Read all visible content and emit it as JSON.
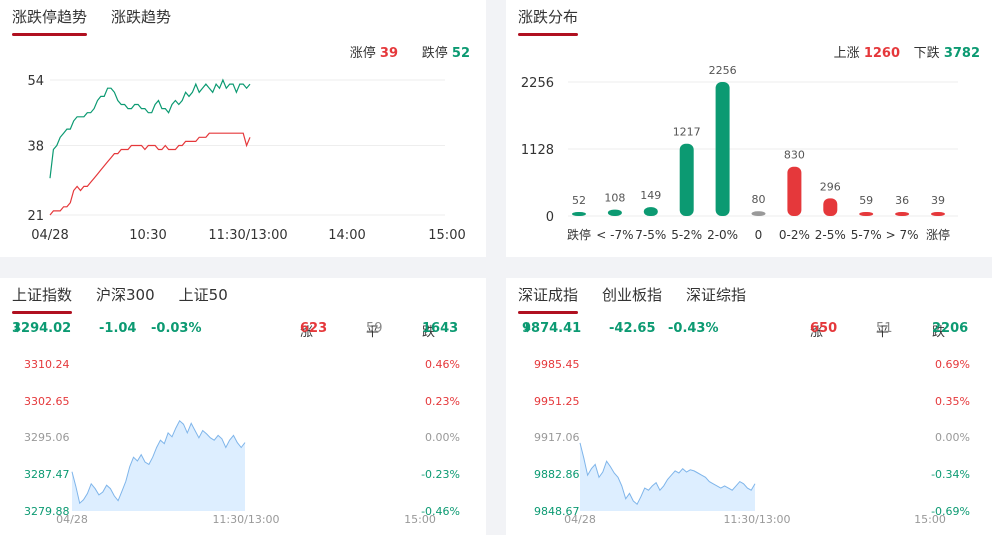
{
  "limit_panel": {
    "tabs": [
      {
        "label": "涨跌停趋势"
      },
      {
        "label": "涨跌趋势"
      }
    ],
    "limit_up_label": "涨停",
    "limit_up_value": "39",
    "limit_down_label": "跌停",
    "limit_down_value": "52",
    "colors": {
      "up": "#e5383b",
      "down": "#0c9a72"
    }
  },
  "dist_panel": {
    "tabs": [
      {
        "label": "涨跌分布"
      }
    ],
    "rise_label": "上涨",
    "rise_value": "1260",
    "fall_label": "下跌",
    "fall_value": "3782"
  },
  "sh_panel": {
    "tabs": [
      {
        "label": "上证指数"
      },
      {
        "label": "沪深300"
      },
      {
        "label": "上证50"
      }
    ],
    "price": "3294.02",
    "change": "-1.04",
    "change_pct": "-0.03%",
    "up_label": "涨",
    "up_value": "623",
    "flat_label": "平",
    "flat_value": "59",
    "down_label": "跌",
    "down_value": "1643"
  },
  "sz_panel": {
    "tabs": [
      {
        "label": "深证成指"
      },
      {
        "label": "创业板指"
      },
      {
        "label": "深证综指"
      }
    ],
    "price": "9874.41",
    "change": "-42.65",
    "change_pct": "-0.43%",
    "up_label": "涨",
    "up_value": "650",
    "flat_label": "平",
    "flat_value": "51",
    "down_label": "跌",
    "down_value": "2206"
  },
  "chart_data": [
    {
      "type": "line",
      "x_ticks": [
        "04/28",
        "10:30",
        "11:30/13:00",
        "14:00",
        "15:00"
      ],
      "y_ticks": [
        54,
        38,
        21
      ],
      "ylim": [
        21,
        54
      ],
      "series": [
        {
          "color": "#0c9a72",
          "values": [
            30,
            37,
            38,
            40,
            41,
            42,
            42,
            44,
            45,
            45,
            45,
            46,
            46,
            47,
            49,
            50,
            50,
            52,
            52,
            51,
            49,
            48,
            48,
            47,
            47,
            48,
            48,
            47,
            47,
            46,
            46,
            48,
            49,
            47,
            47,
            46,
            48,
            49,
            48,
            49,
            51,
            50,
            51,
            53,
            51,
            52,
            53,
            52,
            51,
            53,
            52,
            54,
            52,
            53,
            53,
            51,
            53,
            53,
            52,
            53
          ]
        },
        {
          "color": "#e5383b",
          "values": [
            21,
            22,
            22,
            22,
            23,
            23,
            24,
            27,
            28,
            27,
            28,
            28,
            29,
            30,
            31,
            32,
            33,
            34,
            35,
            36,
            36,
            37,
            37,
            37,
            38,
            38,
            38,
            38,
            37,
            38,
            38,
            38,
            37,
            37,
            38,
            37,
            37,
            37,
            38,
            38,
            39,
            39,
            39,
            39,
            40,
            40,
            40,
            41,
            41,
            41,
            41,
            41,
            41,
            41,
            41,
            41,
            41,
            41,
            38,
            40
          ]
        }
      ]
    },
    {
      "type": "bar",
      "categories": [
        "跌停",
        "< -7%",
        "7-5%",
        "5-2%",
        "2-0%",
        "0",
        "0-2%",
        "2-5%",
        "5-7%",
        "> 7%",
        "涨停"
      ],
      "values": [
        52,
        108,
        149,
        1217,
        2256,
        80,
        830,
        296,
        59,
        36,
        39
      ],
      "colors": [
        "#0c9a72",
        "#0c9a72",
        "#0c9a72",
        "#0c9a72",
        "#0c9a72",
        "#999999",
        "#e5383b",
        "#e5383b",
        "#e5383b",
        "#e5383b",
        "#e5383b"
      ],
      "y_ticks": [
        2256,
        1128,
        0
      ],
      "ylim": [
        0,
        2256
      ]
    },
    {
      "type": "area",
      "x_ticks": [
        "04/28",
        "11:30/13:00",
        "15:00"
      ],
      "y_ticks_left": [
        "3310.24",
        "3302.65",
        "3295.06",
        "3287.47",
        "3279.88"
      ],
      "y_ticks_right": [
        "0.46%",
        "0.23%",
        "0.00%",
        "-0.23%",
        "-0.46%"
      ],
      "ylim": [
        3279.88,
        3310.24
      ],
      "values": [
        3288.0,
        3285.0,
        3281.5,
        3282.2,
        3283.5,
        3285.5,
        3284.5,
        3283.2,
        3283.8,
        3285.2,
        3284.5,
        3283.0,
        3282.0,
        3284.0,
        3286.0,
        3289.0,
        3291.0,
        3290.2,
        3291.5,
        3290.0,
        3289.5,
        3291.0,
        3293.0,
        3294.5,
        3293.8,
        3296.0,
        3295.2,
        3297.0,
        3298.5,
        3297.8,
        3296.0,
        3298.0,
        3296.5,
        3295.0,
        3296.5,
        3295.8,
        3295.0,
        3294.5,
        3295.5,
        3294.8,
        3293.0,
        3294.5,
        3295.5,
        3294.0,
        3293.0,
        3294.0
      ]
    },
    {
      "type": "area",
      "x_ticks": [
        "04/28",
        "11:30/13:00",
        "15:00"
      ],
      "y_ticks_left": [
        "9985.45",
        "9951.25",
        "9917.06",
        "9882.86",
        "9848.67"
      ],
      "y_ticks_right": [
        "0.69%",
        "0.35%",
        "0.00%",
        "-0.34%",
        "-0.69%"
      ],
      "ylim": [
        9848.67,
        9985.45
      ],
      "values": [
        9912,
        9898,
        9882,
        9888,
        9892,
        9880,
        9885,
        9895,
        9890,
        9884,
        9880,
        9872,
        9860,
        9865,
        9858,
        9855,
        9862,
        9870,
        9868,
        9872,
        9875,
        9868,
        9872,
        9878,
        9882,
        9886,
        9884,
        9888,
        9885,
        9887,
        9886,
        9884,
        9882,
        9880,
        9876,
        9874,
        9872,
        9870,
        9872,
        9870,
        9868,
        9872,
        9876,
        9874,
        9870,
        9868,
        9874
      ]
    }
  ]
}
